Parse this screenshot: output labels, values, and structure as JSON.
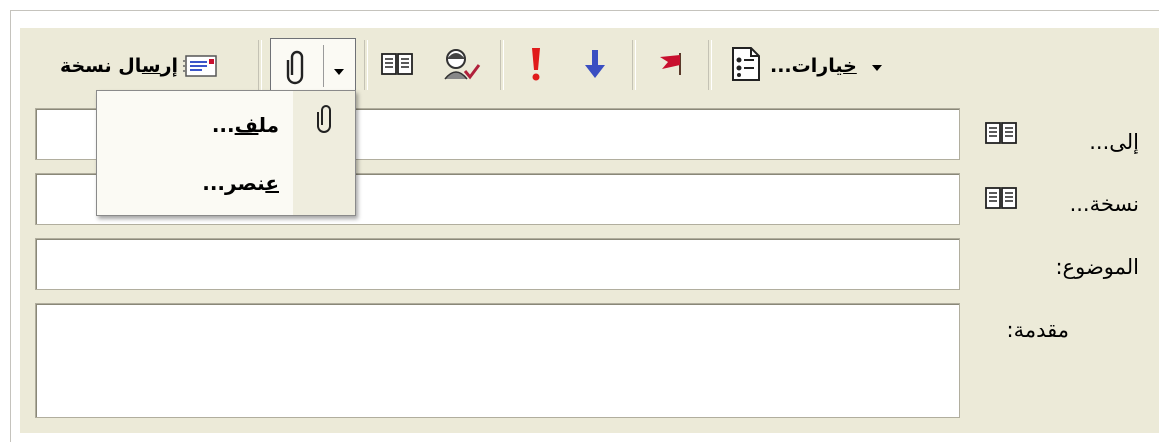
{
  "toolbar": {
    "send_copy_prefix": "إر",
    "send_copy_mnemonic": "س",
    "send_copy_rest": "ال نسخة",
    "options_mnemonic": "خ",
    "options_rest": "يارات...",
    "icons": {
      "send_copy": "envelope-icon",
      "attach": "paperclip-icon",
      "address_book": "address-book-icon",
      "check_names": "check-names-icon",
      "high_importance": "exclamation-icon",
      "low_importance": "down-arrow-icon",
      "flag": "flag-icon",
      "options": "options-icon",
      "dropdown": "dropdown-arrow-icon"
    },
    "colors": {
      "exclamation": "#e01b1b",
      "arrow": "#3a4fc2",
      "flag": "#c8102e"
    }
  },
  "attach_menu": {
    "file_mnemonic": "ف",
    "file_prefix": "مل",
    "file_suffix": "...",
    "item_mnemonic": "ع",
    "item_rest": "نصر..."
  },
  "fields": {
    "to_label": "إلى...",
    "cc_label": "نسخة...",
    "subject_label": "الموضوع:",
    "intro_label": "مقدمة:",
    "to_value": "",
    "cc_value": "",
    "subject_value": "",
    "intro_value": ""
  }
}
